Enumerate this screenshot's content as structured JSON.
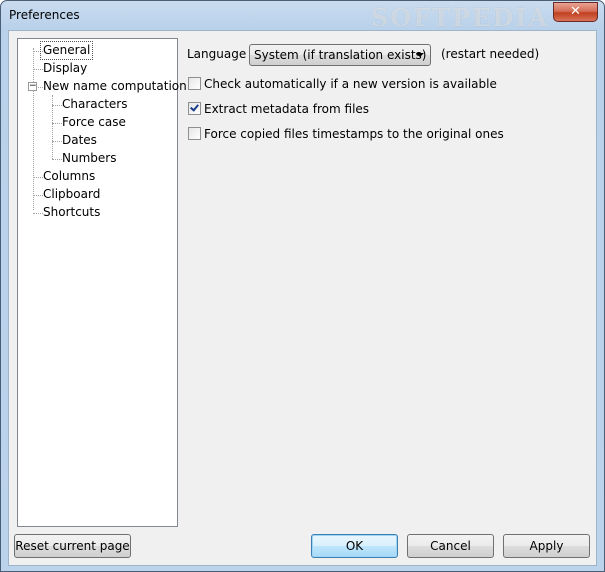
{
  "window": {
    "title": "Preferences",
    "close_glyph": "✕",
    "watermark": "SOFTPEDIA"
  },
  "tree": {
    "items": [
      {
        "label": "General",
        "selected": true
      },
      {
        "label": "Display"
      },
      {
        "label": "New name computation",
        "expanded": true,
        "expander": "−"
      },
      {
        "label": "Characters"
      },
      {
        "label": "Force case"
      },
      {
        "label": "Dates"
      },
      {
        "label": "Numbers"
      },
      {
        "label": "Columns"
      },
      {
        "label": "Clipboard"
      },
      {
        "label": "Shortcuts"
      }
    ]
  },
  "general": {
    "language_label": "Language",
    "language_value": "System (if translation exists)",
    "restart_note": "(restart needed)",
    "checkboxes": [
      {
        "label": "Check automatically if a new version is available",
        "checked": false
      },
      {
        "label": "Extract metadata from files",
        "checked": true
      },
      {
        "label": "Force copied files timestamps to the original ones",
        "checked": false
      }
    ]
  },
  "buttons": {
    "reset": "Reset current page",
    "ok": "OK",
    "cancel": "Cancel",
    "apply": "Apply"
  }
}
